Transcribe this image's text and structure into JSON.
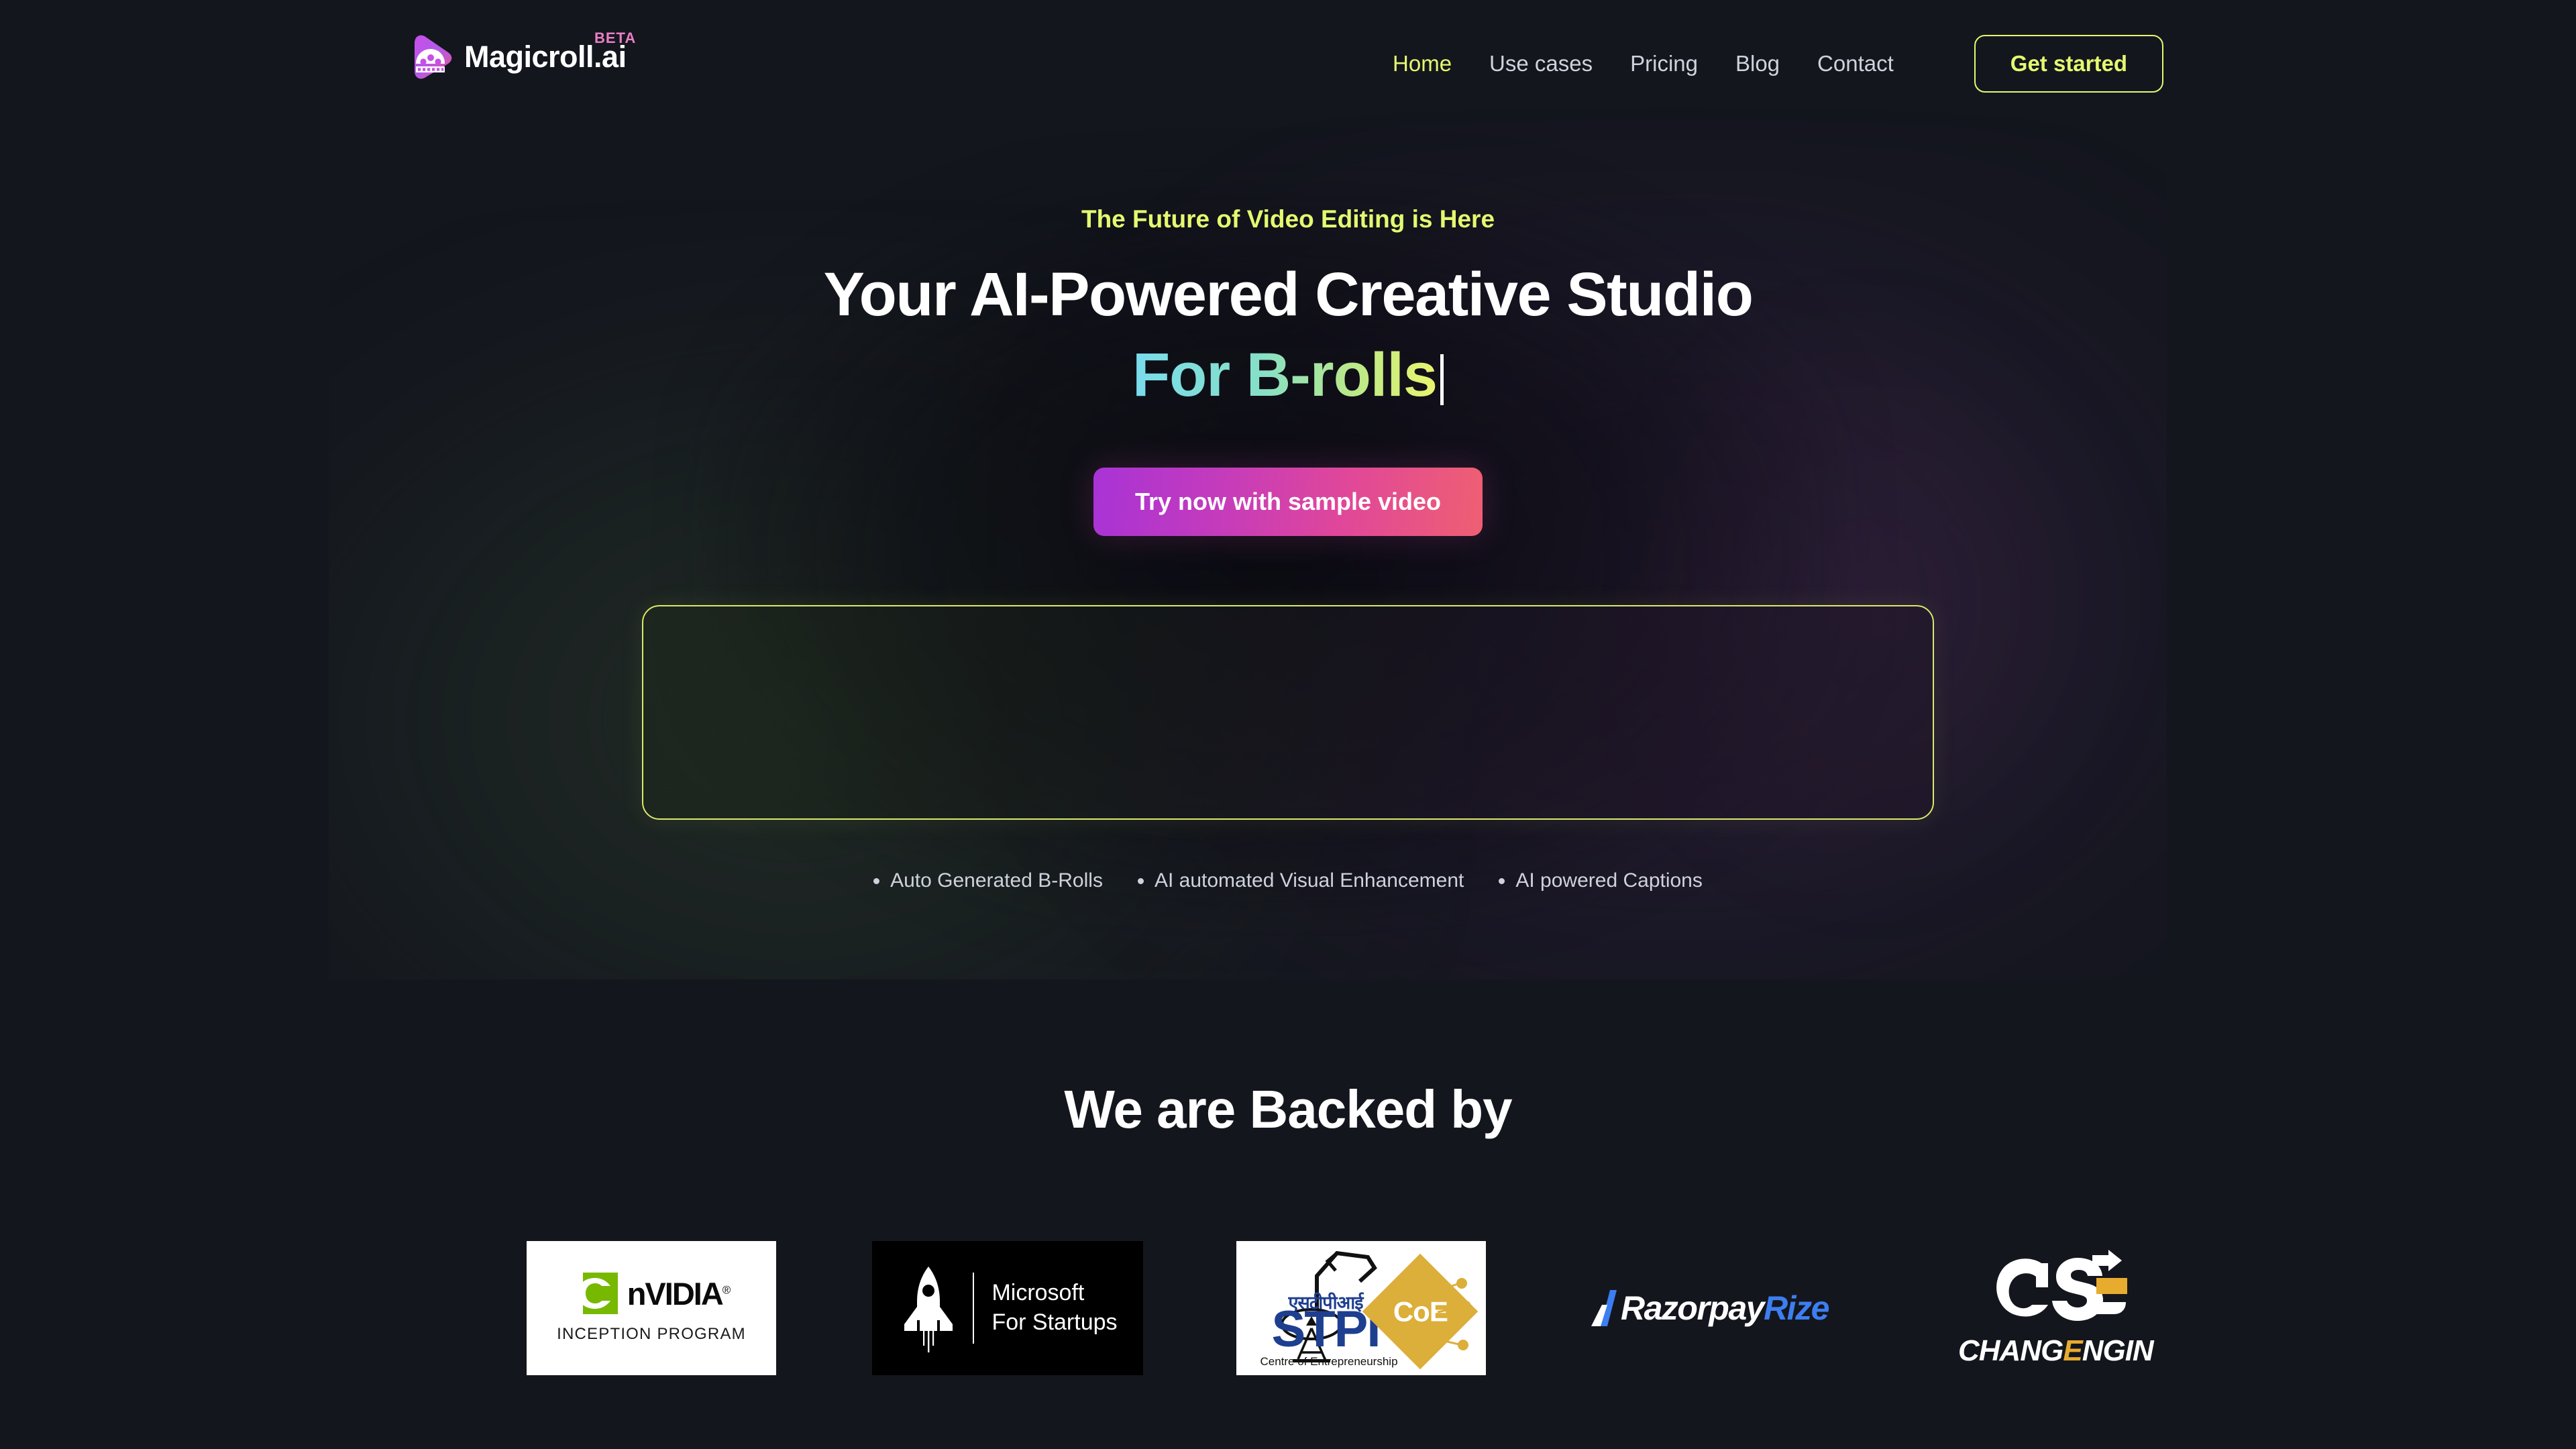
{
  "brand": {
    "name": "Magicroll.ai",
    "badge": "BETA",
    "logo_icon": "play-film-reel-icon"
  },
  "nav": {
    "links": [
      {
        "label": "Home",
        "active": true
      },
      {
        "label": "Use cases",
        "active": false
      },
      {
        "label": "Pricing",
        "active": false
      },
      {
        "label": "Blog",
        "active": false
      },
      {
        "label": "Contact",
        "active": false
      }
    ],
    "cta_label": "Get started"
  },
  "hero": {
    "tagline": "The Future of Video Editing is Here",
    "headline_line1": "Your AI-Powered Creative Studio",
    "headline_line2": "For B-rolls",
    "cta_label": "Try now with sample video",
    "features": [
      "Auto Generated B-Rolls",
      "AI automated Visual Enhancement",
      "AI powered Captions"
    ]
  },
  "backed": {
    "title": "We are Backed by",
    "logos": [
      {
        "name": "NVIDIA Inception Program",
        "word": "nVIDIA",
        "reg": "®",
        "sub": "INCEPTION PROGRAM"
      },
      {
        "name": "Microsoft For Startups",
        "line1": "Microsoft",
        "line2": "For Startups"
      },
      {
        "name": "STPI Centre of Entrepreneurship",
        "hindi": "एसटीपीआई",
        "word": "STPI",
        "badge": "CoE",
        "sub": "Centre of Entrepreneurship"
      },
      {
        "name": "Razorpay Rize",
        "part1": "Razorpay",
        "part2": "Rize"
      },
      {
        "name": "ChangeEngine",
        "word_a": "CHANG",
        "word_gold": "E",
        "word_b": "NGIN"
      }
    ]
  },
  "colors": {
    "background": "#14161e",
    "accent": "#e4f96f",
    "beta": "#e97fc4",
    "cta_gradient_start": "#a833d6",
    "cta_gradient_end": "#ef5f72",
    "heading_gradient_start": "#79dced",
    "heading_gradient_end": "#e9f56e",
    "razorpay_blue": "#3d7ef0",
    "nvidia_green": "#76b900",
    "stpi_blue": "#1e3f8f",
    "stpi_gold": "#dcae3a",
    "changeengine_gold": "#e7ab2e"
  }
}
